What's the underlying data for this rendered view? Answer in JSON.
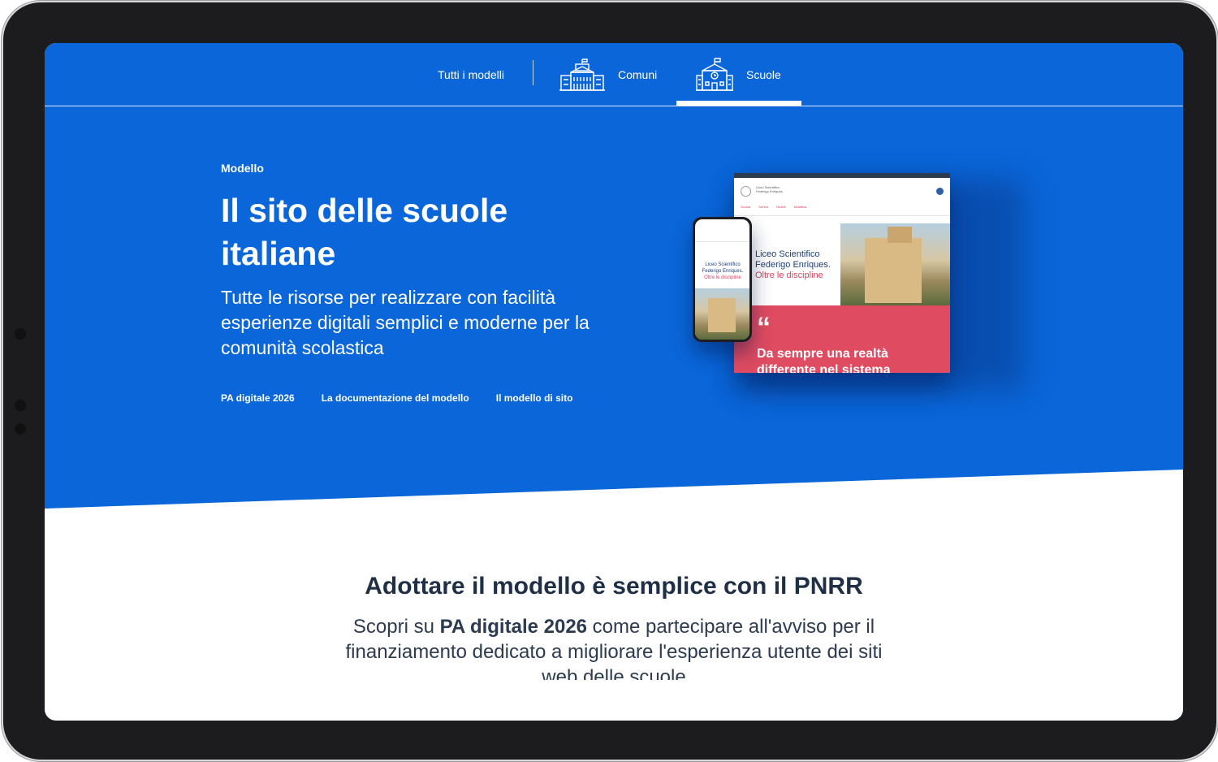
{
  "nav": {
    "all_label": "Tutti i modelli",
    "comuni_label": "Comuni",
    "scuole_label": "Scuole",
    "active": "Scuole"
  },
  "hero": {
    "eyebrow": "Modello",
    "title": "Il sito delle scuole italiane",
    "subtitle": "Tutte le risorse per realizzare con facilità esperienze digitali semplici e moderne per la comunità scolastica",
    "links": [
      "PA digitale 2026",
      "La documentazione del modello",
      "Il modello di sito"
    ]
  },
  "mockup": {
    "school_line1": "Liceo Scientifico",
    "school_line2": "Federigo Enriques.",
    "school_line3": "Oltre le discipline",
    "quote_text": "Da sempre una realtà differente nel sistema",
    "menu_items": [
      "Scuola",
      "Servizi",
      "Novità",
      "Didattica"
    ]
  },
  "section": {
    "title": "Adottare il modello è semplice con il PNRR",
    "text_before": "Scopri su ",
    "text_bold": "PA digitale 2026",
    "text_after": " come partecipare all'avviso per il finanziamento dedicato a migliorare l'esperienza utente dei siti web delle scuole"
  },
  "colors": {
    "brand_blue": "#0a66d9",
    "accent_pink": "#df4b61",
    "dark_text": "#1f2f45"
  }
}
